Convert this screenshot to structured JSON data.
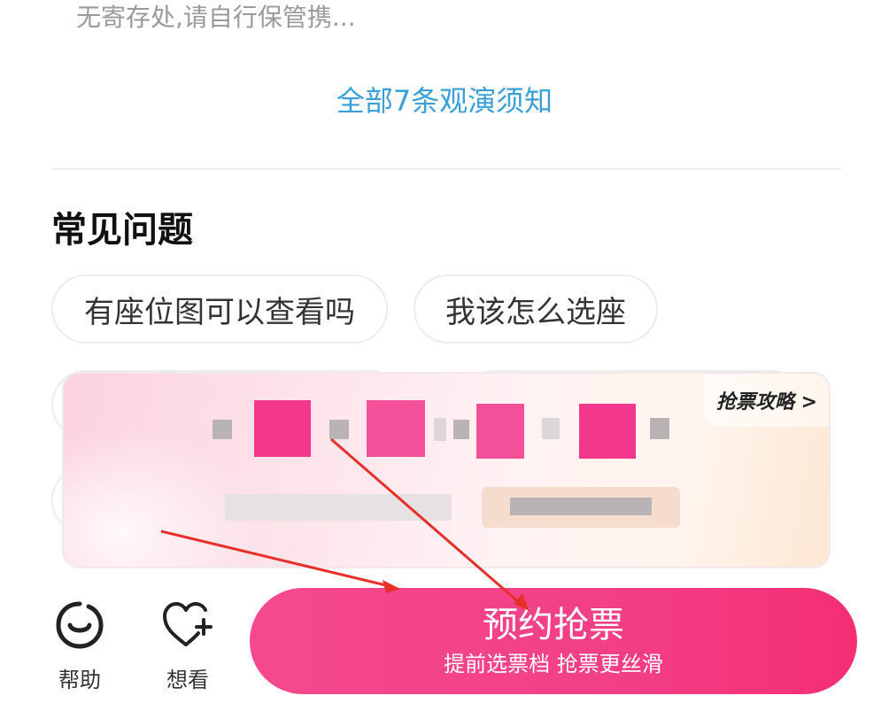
{
  "notices": {
    "truncated_text": "无寄存处,请自行保管携...",
    "all_link": "全部7条观演须知"
  },
  "faq": {
    "title": "常见问题",
    "chips": [
      {
        "label": "有座位图可以查看吗"
      },
      {
        "label": "我该怎么选座"
      }
    ]
  },
  "promo": {
    "tag": "抢票攻略 >"
  },
  "bottom_bar": {
    "help_label": "帮助",
    "want_label": "想看",
    "cta_main": "预约抢票",
    "cta_sub": "提前选票档 抢票更丝滑"
  },
  "colors": {
    "link": "#3a9ed8",
    "cta": "#f23f86",
    "annotation_arrow": "#e8302a"
  },
  "icons": {
    "help": "smile-face-icon",
    "want": "heart-plus-icon",
    "promo_chevron": "chevron-right-icon"
  }
}
